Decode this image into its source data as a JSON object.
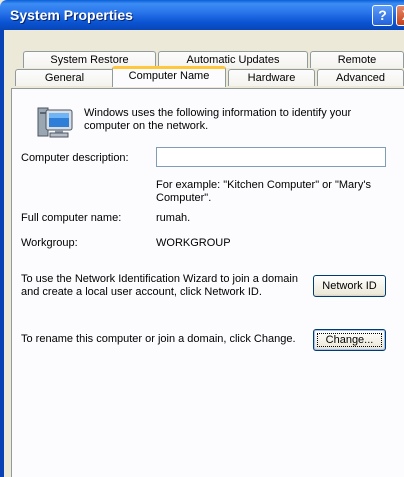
{
  "window": {
    "title": "System Properties",
    "help_glyph": "?",
    "close_glyph": "X"
  },
  "tabs": {
    "row1": [
      "System Restore",
      "Automatic Updates",
      "Remote"
    ],
    "row2": [
      "General",
      "Computer Name",
      "Hardware",
      "Advanced"
    ],
    "active": "Computer Name"
  },
  "panel": {
    "intro": "Windows uses the following information to identify your computer on the network.",
    "description_label": "Computer description:",
    "description_value": "",
    "example": "For example: \"Kitchen Computer\" or \"Mary's Computer\".",
    "full_name_label": "Full computer name:",
    "full_name_value": "rumah.",
    "workgroup_label": "Workgroup:",
    "workgroup_value": "WORKGROUP",
    "network_id_text": "To use the Network Identification Wizard to join a domain and create a local user account, click Network ID.",
    "network_id_button": "Network ID",
    "rename_text": "To rename this computer or join a domain, click Change.",
    "change_button": "Change..."
  }
}
